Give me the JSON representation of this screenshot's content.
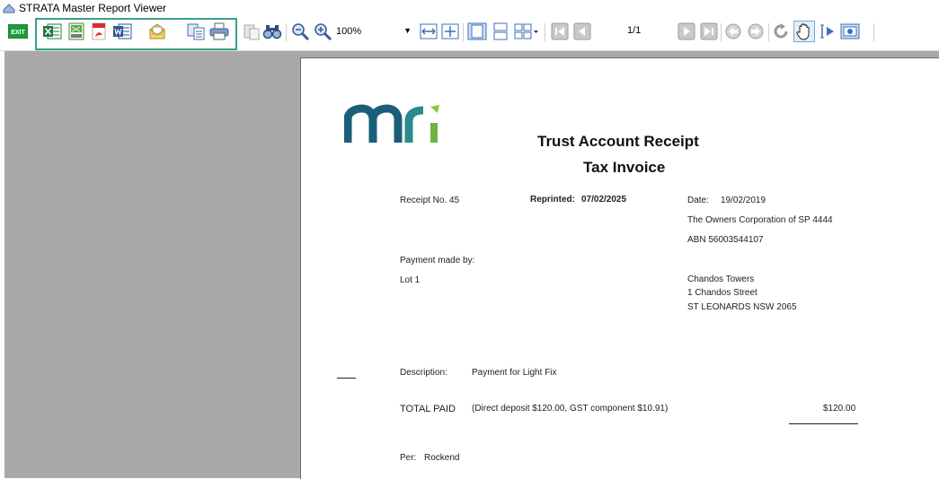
{
  "window": {
    "title": "STRATA Master Report Viewer"
  },
  "toolbar": {
    "exit_label": "EXIT",
    "zoom_value": "100%",
    "page_indicator": "1/1",
    "icons": [
      "exit-icon",
      "excel-icon",
      "csv-icon",
      "pdf-icon",
      "word-icon",
      "email-icon",
      "copy-icon",
      "print-icon",
      "paste-icon",
      "find-icon",
      "zoom-out-icon",
      "zoom-in-icon",
      "fit-width-icon",
      "fit-page-icon",
      "single-page-icon",
      "continuous-icon",
      "multi-page-icon",
      "first-page-icon",
      "prev-page-icon",
      "next-page-icon",
      "last-page-icon",
      "back-icon",
      "forward-icon",
      "refresh-icon",
      "hand-tool-icon",
      "select-tool-icon",
      "snapshot-icon"
    ]
  },
  "report": {
    "logo_text": "mri",
    "title": "Trust Account Receipt",
    "subtitle": "Tax Invoice",
    "receipt_no": "Receipt No. 45",
    "reprinted_label": "Reprinted:",
    "reprinted_date": "07/02/2025",
    "date_label": "Date:",
    "date_value": "19/02/2019",
    "owner_corp": "The Owners Corporation of SP 4444",
    "abn": "ABN 56003544107",
    "payment_made_by": "Payment made by:",
    "lot": "Lot 1",
    "address_line1": "Chandos Towers",
    "address_line2": "1 Chandos Street",
    "address_line3": "ST LEONARDS  NSW  2065",
    "description_label": "Description:",
    "description_value": "Payment for Light Fix",
    "total_paid_label": "TOTAL PAID",
    "total_paid_detail": "(Direct deposit $120.00, GST component $10.91)",
    "total_amount": "$120.00",
    "per_label": "Per:",
    "per_value": "Rockend"
  }
}
